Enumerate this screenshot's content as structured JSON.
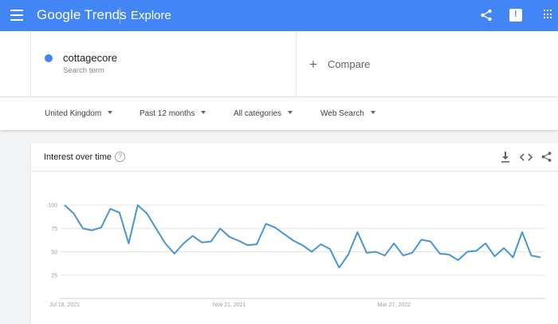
{
  "appbar": {
    "brand": "Google Trends",
    "page": "Explore",
    "icons": [
      "menu-icon",
      "share-icon",
      "feedback-icon",
      "apps-icon"
    ]
  },
  "search_term": {
    "name": "cottagecore",
    "type": "Search term",
    "color": "#4285f4"
  },
  "compare": {
    "label": "Compare"
  },
  "filters": {
    "region": "United Kingdom",
    "time": "Past 12 months",
    "category": "All categories",
    "search_type": "Web Search"
  },
  "card": {
    "title": "Interest over time",
    "icons": [
      "help-icon",
      "download-icon",
      "embed-icon",
      "share-icon"
    ]
  },
  "chart_data": {
    "type": "line",
    "title": "Interest over time",
    "y_ticks": [
      "100",
      "75",
      "50",
      "25"
    ],
    "y_range": [
      0,
      100
    ],
    "x_tick_labels": [
      "Jul 18, 2021",
      "Nov 21, 2021",
      "Mar 27, 2022"
    ],
    "grid": true,
    "series": [
      {
        "name": "cottagecore",
        "color": "#4796d4",
        "values": [
          100,
          91,
          75,
          73,
          76,
          96,
          92,
          59,
          100,
          91,
          75,
          59,
          48,
          59,
          67,
          60,
          61,
          75,
          66,
          62,
          57,
          58,
          80,
          76,
          69,
          62,
          57,
          50,
          58,
          53,
          33,
          47,
          71,
          49,
          50,
          46,
          59,
          46,
          49,
          63,
          61,
          48,
          47,
          41,
          50,
          51,
          59,
          45,
          54,
          44,
          71,
          46,
          44
        ]
      }
    ]
  }
}
